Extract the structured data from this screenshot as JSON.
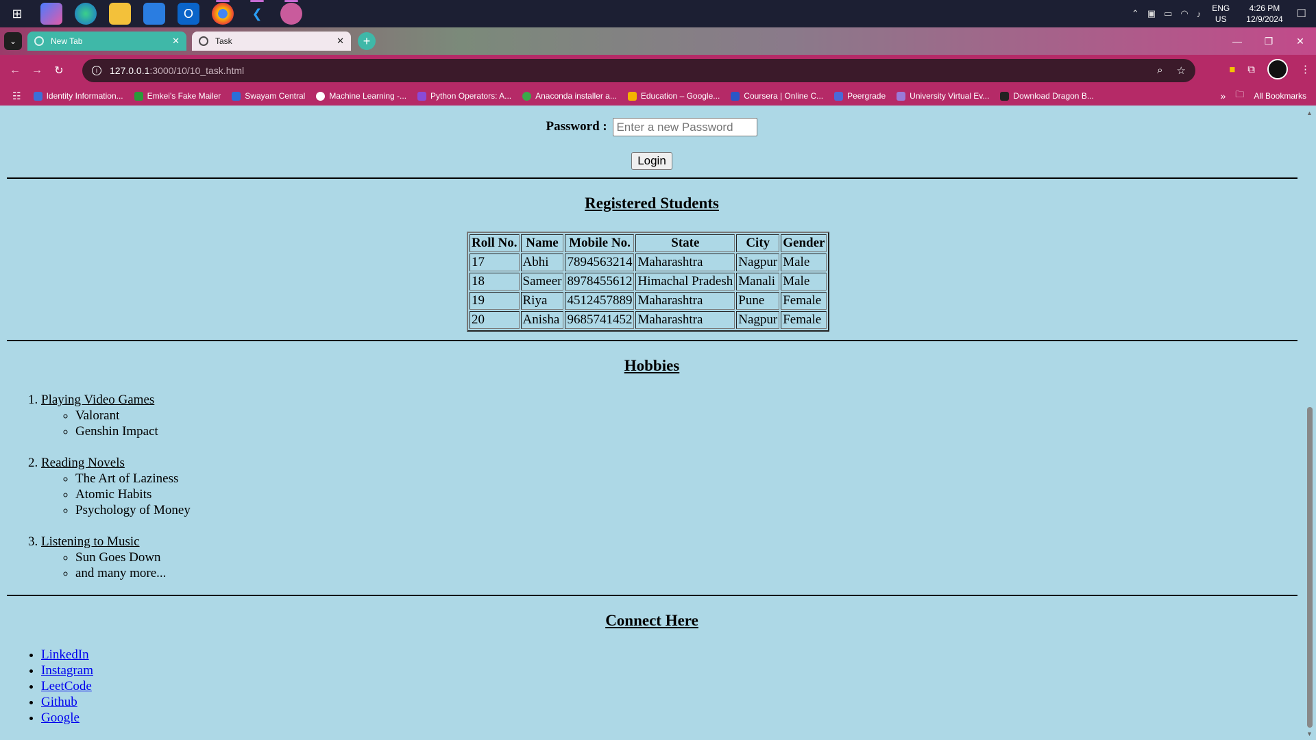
{
  "taskbar": {
    "apps": [
      "start",
      "copilot",
      "edge",
      "file-explorer",
      "store",
      "outlook",
      "chrome",
      "vscode",
      "discord"
    ],
    "lang_top": "ENG",
    "lang_bottom": "US",
    "time": "4:26 PM",
    "date": "12/9/2024"
  },
  "browser": {
    "tabs": [
      {
        "label": "New Tab",
        "active": false
      },
      {
        "label": "Task",
        "active": true
      }
    ],
    "url_host": "127.0.0.1",
    "url_path": ":3000/10/10_task.html",
    "bookmarks": [
      "Identity Information...",
      "Emkei's Fake Mailer",
      "Swayam Central",
      "Machine Learning -...",
      "Python Operators: A...",
      "Anaconda installer a...",
      "Education – Google...",
      "Coursera | Online C...",
      "Peergrade",
      "University Virtual Ev...",
      "Download Dragon B..."
    ],
    "all_bookmarks": "All Bookmarks"
  },
  "form": {
    "password_label": "Password :",
    "password_placeholder": "Enter a new Password",
    "login_label": "Login"
  },
  "students": {
    "heading": "Registered Students",
    "columns": [
      "Roll No.",
      "Name",
      "Mobile No.",
      "State",
      "City",
      "Gender"
    ],
    "rows": [
      [
        "17",
        "Abhi",
        "7894563214",
        "Maharashtra",
        "Nagpur",
        "Male"
      ],
      [
        "18",
        "Sameer",
        "8978455612",
        "Himachal Pradesh",
        "Manali",
        "Male"
      ],
      [
        "19",
        "Riya",
        "4512457889",
        "Maharashtra",
        "Pune",
        "Female"
      ],
      [
        "20",
        "Anisha",
        "9685741452",
        "Maharashtra",
        "Nagpur",
        "Female"
      ]
    ]
  },
  "hobbies": {
    "heading": "Hobbies",
    "items": [
      {
        "title": "Playing Video Games",
        "subs": [
          "Valorant",
          "Genshin Impact"
        ]
      },
      {
        "title": "Reading Novels",
        "subs": [
          "The Art of Laziness",
          "Atomic Habits",
          "Psychology of Money"
        ]
      },
      {
        "title": "Listening to Music",
        "subs": [
          "Sun Goes Down",
          "and many more..."
        ]
      }
    ]
  },
  "connect": {
    "heading": "Connect Here",
    "links": [
      "LinkedIn",
      "Instagram",
      "LeetCode",
      "Github",
      "Google"
    ]
  }
}
